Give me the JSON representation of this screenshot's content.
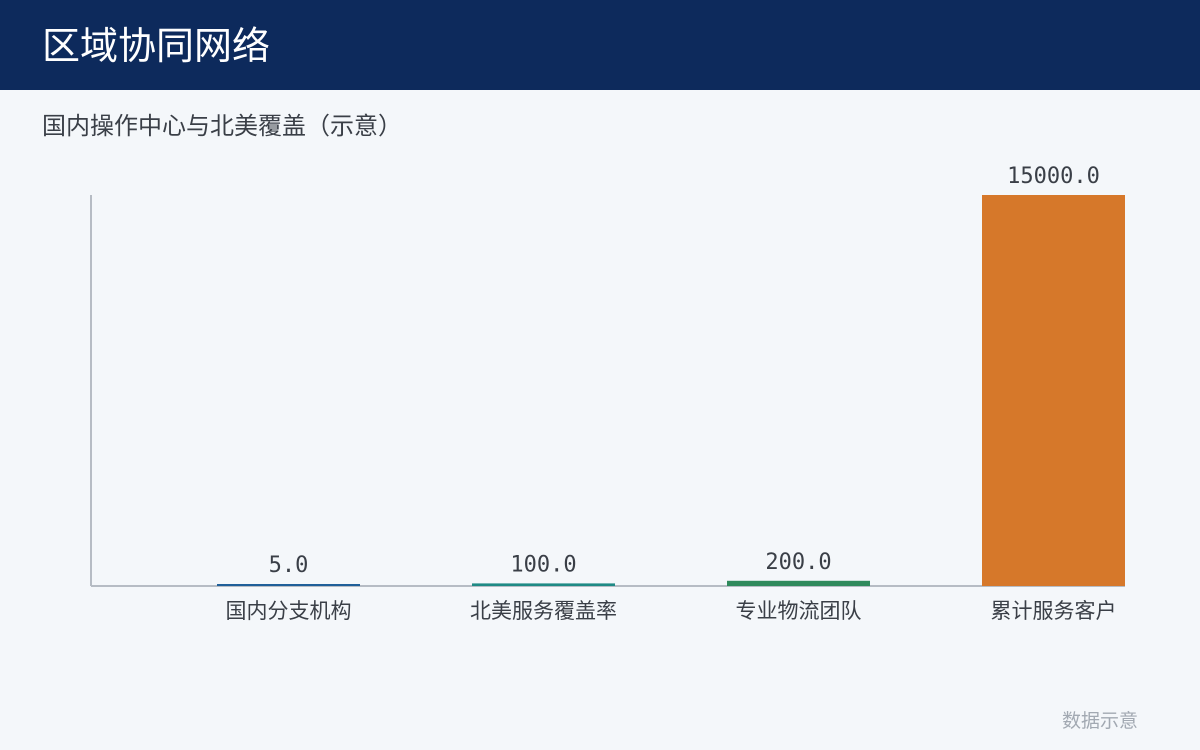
{
  "header": {
    "title": "区域协同网络"
  },
  "chart_data": {
    "type": "bar",
    "title": "国内操作中心与北美覆盖（示意）",
    "categories": [
      "国内分支机构",
      "北美服务覆盖率",
      "专业物流团队",
      "累计服务客户"
    ],
    "values": [
      5.0,
      100.0,
      200.0,
      15000.0
    ],
    "value_labels": [
      "5.0",
      "100.0",
      "200.0",
      "15000.0"
    ],
    "colors": [
      "#1f5f99",
      "#1f8a85",
      "#2f8a5c",
      "#d6782a"
    ],
    "ylim": [
      0,
      15000
    ],
    "grid": false,
    "legend": "none",
    "xlabel": "",
    "ylabel": ""
  },
  "footer": {
    "note": "数据示意"
  }
}
